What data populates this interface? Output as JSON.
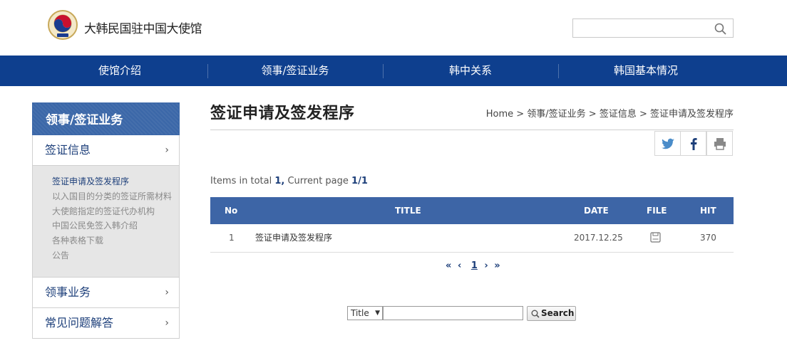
{
  "header": {
    "site_title": "大韩民国驻中国大使馆",
    "search_placeholder": ""
  },
  "nav": [
    "使馆介绍",
    "领事/签证业务",
    "韩中关系",
    "韩国基本情况"
  ],
  "sidebar": {
    "heading": "领事/签证业务",
    "section1": {
      "label": "签证信息",
      "chevron": "›"
    },
    "sub_items": [
      "签证申请及签发程序",
      "以入国目的分类的签证所需材料",
      "大使館指定的签证代办机构",
      "中国公民免签入韩介绍",
      "各种表格下载",
      "公告"
    ],
    "section2": {
      "label": "领事业务",
      "chevron": "›"
    },
    "section3": {
      "label": "常见问题解答",
      "chevron": "›"
    }
  },
  "content": {
    "title": "签证申请及签发程序",
    "breadcrumb": "Home > 领事/签证业务 > 签证信息 > 签证申请及签发程序",
    "counter": {
      "prefix": "Items in total ",
      "total": "1,",
      "middle": " Current page ",
      "page": "1/1"
    },
    "table": {
      "headers": {
        "no": "No",
        "title": "TITLE",
        "date": "DATE",
        "file": "FILE",
        "hit": "HIT"
      },
      "rows": [
        {
          "no": "1",
          "title": "签证申请及签发程序",
          "date": "2017.12.25",
          "hit": "370"
        }
      ]
    },
    "pager": {
      "first": "«",
      "prev": "‹",
      "current": "1",
      "next": "›",
      "last": "»"
    },
    "search": {
      "select_value": "Title",
      "select_arrow": "▼",
      "button_label": "Search"
    }
  },
  "colors": {
    "nav_bg": "#0e3f8e",
    "table_head": "#3d65a6",
    "side_head": "#3b67a8",
    "link": "#1d3f7a"
  },
  "icons": [
    "emblem-logo",
    "search-icon",
    "twitter-icon",
    "facebook-icon",
    "print-icon",
    "file-icon",
    "magnifier-icon"
  ]
}
